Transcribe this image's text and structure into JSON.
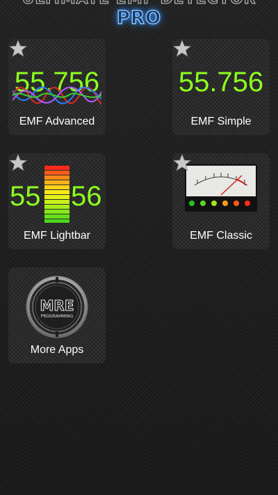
{
  "header": {
    "title": "ULTIMATE EMF DETECTOR",
    "subtitle": "PRO"
  },
  "tiles": [
    {
      "label": "EMF Advanced",
      "value": "55.756",
      "favorite_icon": "star-icon"
    },
    {
      "label": "EMF Simple",
      "value": "55.756",
      "favorite_icon": "star-icon"
    },
    {
      "label": "EMF Lightbar",
      "value_left": "55",
      "value_right": "56",
      "favorite_icon": "star-icon"
    },
    {
      "label": "EMF Classic",
      "favorite_icon": "star-icon"
    },
    {
      "label": "More Apps",
      "logo_line1": "MRE",
      "logo_line2": "PROGRAMMING"
    }
  ],
  "colors": {
    "reading_green": "#8dff1f",
    "header_glow": "#2f8fff",
    "tile_label": "#ffffff"
  }
}
